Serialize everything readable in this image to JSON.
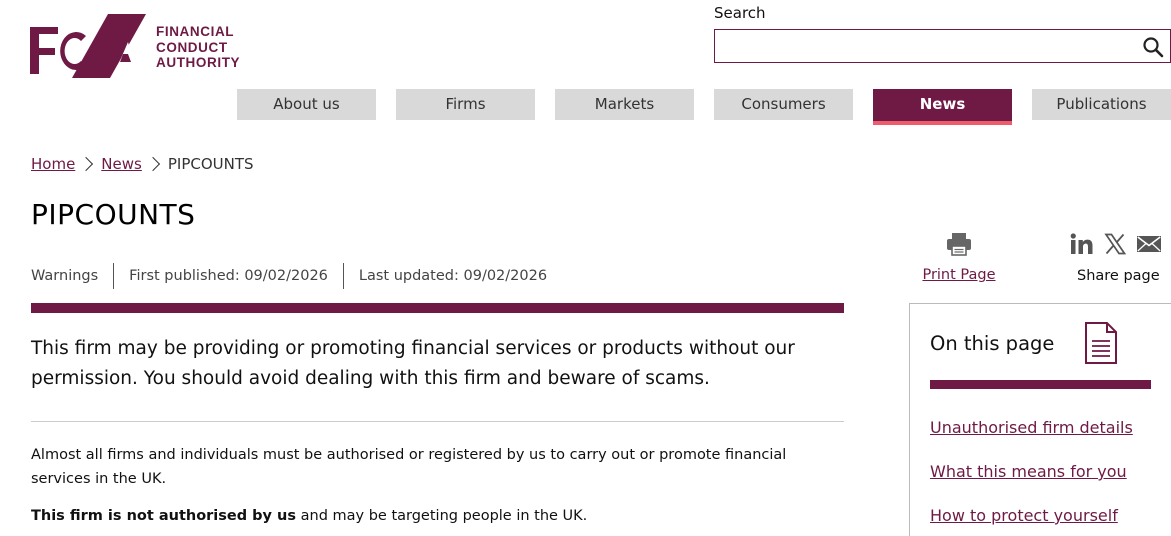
{
  "header": {
    "logo_text_line1": "FINANCIAL",
    "logo_text_line2": "CONDUCT",
    "logo_text_line3": "AUTHORITY",
    "logo_letters": "FCA",
    "search_label": "Search",
    "search_placeholder": "",
    "search_value": ""
  },
  "nav": {
    "items": [
      {
        "label": "About us"
      },
      {
        "label": "Firms"
      },
      {
        "label": "Markets"
      },
      {
        "label": "Consumers"
      },
      {
        "label": "News"
      },
      {
        "label": "Publications"
      }
    ],
    "active": "News"
  },
  "breadcrumb": {
    "home": "Home",
    "news": "News",
    "current": "PIPCOUNTS"
  },
  "page": {
    "title": "PIPCOUNTS",
    "category": "Warnings",
    "first_published": "First published: 09/02/2026",
    "last_updated": "Last updated: 09/02/2026",
    "warning": "This firm may be providing or promoting financial services or products without our permission. You should avoid dealing with this firm and beware of scams.",
    "para1": "Almost all firms and individuals must be authorised or registered by us to carry out or promote financial services in the UK.",
    "para2_bold": "This firm is not authorised by us",
    "para2_rest": " and may be targeting people in the UK."
  },
  "tools": {
    "print_label": "Print Page",
    "share_label": "Share page",
    "share_icons": [
      "linkedin-icon",
      "x-icon",
      "email-icon"
    ]
  },
  "on_this_page": {
    "title": "On this page",
    "links": [
      "Unauthorised firm details",
      "What this means for you",
      "How to protect yourself"
    ]
  },
  "colors": {
    "brand": "#6e1a44",
    "accent_underline": "#ee5d6c",
    "tab_bg": "#d9d9d9"
  }
}
